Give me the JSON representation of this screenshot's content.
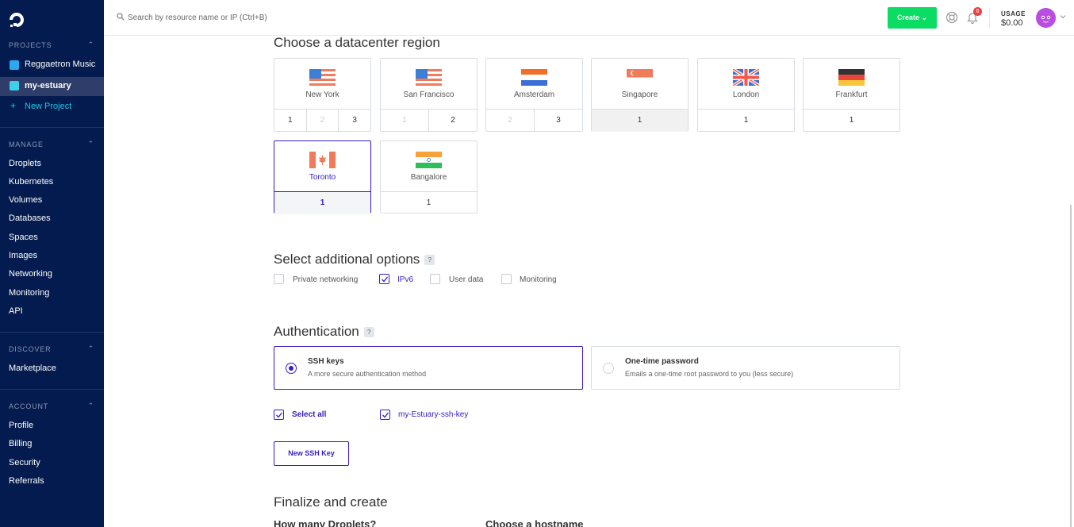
{
  "sidebar": {
    "projects_header": "PROJECTS",
    "projects": [
      {
        "label": "Reggaetron Music",
        "color": "#2ba9ef"
      },
      {
        "label": "my-estuary",
        "color": "#3fd0ea"
      }
    ],
    "new_project": "New Project",
    "manage_header": "MANAGE",
    "manage": [
      "Droplets",
      "Kubernetes",
      "Volumes",
      "Databases",
      "Spaces",
      "Images",
      "Networking",
      "Monitoring",
      "API"
    ],
    "discover_header": "DISCOVER",
    "discover": [
      "Marketplace"
    ],
    "account_header": "ACCOUNT",
    "account": [
      "Profile",
      "Billing",
      "Security",
      "Referrals"
    ]
  },
  "topbar": {
    "search_placeholder": "Search by resource name or IP (Ctrl+B)",
    "create_label": "Create",
    "notification_count": "6",
    "usage_label": "USAGE",
    "usage_value": "$0.00"
  },
  "region": {
    "title": "Choose a datacenter region",
    "cards": [
      {
        "name": "New York",
        "flag": "us",
        "dcs": [
          {
            "n": "1",
            "d": false
          },
          {
            "n": "2",
            "d": true
          },
          {
            "n": "3",
            "d": false
          }
        ],
        "state": "normal"
      },
      {
        "name": "San Francisco",
        "flag": "us",
        "dcs": [
          {
            "n": "1",
            "d": true
          },
          {
            "n": "2",
            "d": false
          }
        ],
        "state": "normal"
      },
      {
        "name": "Amsterdam",
        "flag": "nl",
        "dcs": [
          {
            "n": "2",
            "d": true
          },
          {
            "n": "3",
            "d": false
          }
        ],
        "state": "normal"
      },
      {
        "name": "Singapore",
        "flag": "sg",
        "dcs": [
          {
            "n": "1",
            "d": false
          }
        ],
        "state": "gray"
      },
      {
        "name": "London",
        "flag": "gb",
        "dcs": [
          {
            "n": "1",
            "d": false
          }
        ],
        "state": "normal"
      },
      {
        "name": "Frankfurt",
        "flag": "de",
        "dcs": [
          {
            "n": "1",
            "d": false
          }
        ],
        "state": "normal"
      },
      {
        "name": "Toronto",
        "flag": "ca",
        "dcs": [
          {
            "n": "1",
            "d": false
          }
        ],
        "state": "selected"
      },
      {
        "name": "Bangalore",
        "flag": "in",
        "dcs": [
          {
            "n": "1",
            "d": false
          }
        ],
        "state": "normal"
      }
    ]
  },
  "options": {
    "title": "Select additional options",
    "help": "?",
    "items": [
      {
        "label": "Private networking",
        "checked": false
      },
      {
        "label": "IPv6",
        "checked": true
      },
      {
        "label": "User data",
        "checked": false
      },
      {
        "label": "Monitoring",
        "checked": false
      }
    ]
  },
  "auth": {
    "title": "Authentication",
    "help": "?",
    "ssh_title": "SSH keys",
    "ssh_desc": "A more secure authentication method",
    "otp_title": "One-time password",
    "otp_desc": "Emails a one-time root password to you (less secure)",
    "select_all": "Select all",
    "key_name": "my-Estuary-ssh-key",
    "new_key": "New SSH Key"
  },
  "finalize": {
    "title": "Finalize and create",
    "how_many": "How many Droplets?",
    "hostname": "Choose a hostname"
  }
}
